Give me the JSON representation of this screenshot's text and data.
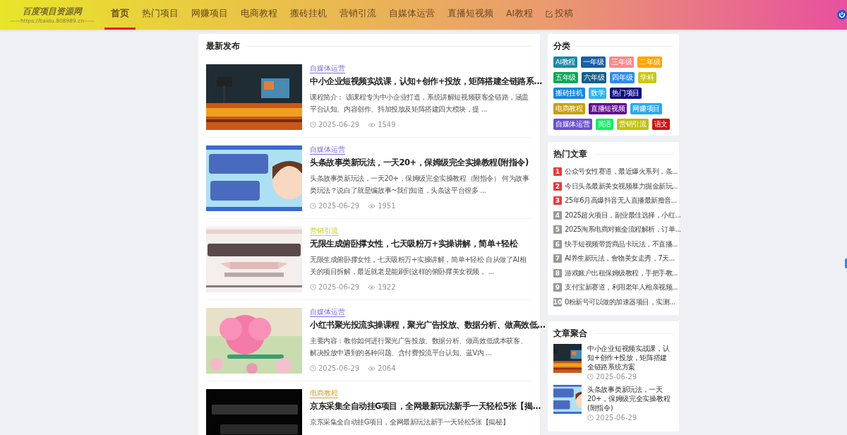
{
  "header": {
    "logo_title": "百度项目资源网",
    "logo_subtitle": "——https://baidu.808989.cn——",
    "nav": [
      {
        "label": "首页",
        "selected": true
      },
      {
        "label": "热门项目",
        "selected": false
      },
      {
        "label": "网赚项目",
        "selected": false
      },
      {
        "label": "电商教程",
        "selected": false
      },
      {
        "label": "搬砖挂机",
        "selected": false
      },
      {
        "label": "营销引流",
        "selected": false
      },
      {
        "label": "自媒体运营",
        "selected": false
      },
      {
        "label": "直播短视频",
        "selected": false
      },
      {
        "label": "AI教程",
        "selected": false
      },
      {
        "label": "投稿",
        "selected": false,
        "kind": "edit"
      }
    ]
  },
  "latest": {
    "title": "最新发布",
    "posts": [
      {
        "category": "自媒体运营",
        "color": "#7a6ad8",
        "title": "中小企业短视频实战课，认知+创作+投放，矩阵搭建全链路系...",
        "excerpt": "课程简介： 该课程专为中小企业打造，系统讲解短视频获客全链路，涵盖平台认知、内容创作、抖加投放及矩阵搭建四大模块，提 ...",
        "date": "2025-06-29",
        "views": "1549"
      },
      {
        "category": "自媒体运营",
        "color": "#7a6ad8",
        "title": "头条故事类新玩法，一天20+，保姆级完全实操教程(附指令)",
        "excerpt": "头条故事类新玩法，一天20+，保姆级完全实操教程（附指令） 何为故事类玩法？说白了就是编故事~我们知道，头条这平台很多 ...",
        "date": "2025-06-29",
        "views": "1951"
      },
      {
        "category": "营销引流",
        "color": "#c8c81a",
        "title": "无限生成俯卧撑女性，七天吸粉万+实操讲解，简单+轻松",
        "excerpt": "无限生成俯卧撑女性，七天吸粉万+实操讲解，简单+轻松 自从做了AI相关的项目拆解，最近就老是能刷到这样的俯卧撑美女视频， ...",
        "date": "2025-06-29",
        "views": "1922"
      },
      {
        "category": "自媒体运营",
        "color": "#7a6ad8",
        "title": "小红书聚光投流实操课程，聚光广告投放、数据分析、做高效低...",
        "excerpt": "主要内容：教你如何进行聚光广告投放、数据分析、做高效低成本获客、解决投放中遇到的各种问题、含付费投流平台认知、蓝V内 ...",
        "date": "2025-06-29",
        "views": "2064"
      },
      {
        "category": "电商教程",
        "color": "#d0a020",
        "title": "京东采集全自动挂G项目，全网最新玩法新手一天轻松5张【揭...",
        "excerpt": "京东采集全自动挂G项目，全网最新玩法新手一天轻松5张【揭秘】"
      }
    ]
  },
  "categories": {
    "title": "分类",
    "tags": [
      {
        "label": "AI教程",
        "color": "#1a8aa8"
      },
      {
        "label": "一年级",
        "color": "#1a5fa8"
      },
      {
        "label": "三年级",
        "color": "#f88a8a"
      },
      {
        "label": "二年级",
        "color": "#ffa500"
      },
      {
        "label": "五年级",
        "color": "#0ba85a"
      },
      {
        "label": "六年级",
        "color": "#155f86"
      },
      {
        "label": "四年级",
        "color": "#2e8af0"
      },
      {
        "label": "学科",
        "color": "#c8c81a"
      },
      {
        "label": "搬砖挂机",
        "color": "#1a88d8"
      },
      {
        "label": "数学",
        "color": "#2ab4f0"
      },
      {
        "label": "热门项目",
        "color": "#101080"
      },
      {
        "label": "电商教程",
        "color": "#c8a010"
      },
      {
        "label": "直播短视频",
        "color": "#601090"
      },
      {
        "label": "网赚项目",
        "color": "#2aa8f0"
      },
      {
        "label": "自媒体运营",
        "color": "#6a50d0"
      },
      {
        "label": "英语",
        "color": "#10f060"
      },
      {
        "label": "营销引流",
        "color": "#c0c010"
      },
      {
        "label": "语文",
        "color": "#d01010"
      }
    ]
  },
  "hot": {
    "title": "热门文章",
    "items": [
      {
        "rank": "1",
        "color": "#e83a3a",
        "title": "公众号女性赛道，最近爆火系列，条..."
      },
      {
        "rank": "2",
        "color": "#e83a3a",
        "title": "今日头条最新美女视频暴力掘金新玩..."
      },
      {
        "rank": "3",
        "color": "#e83a3a",
        "title": "25年6月高爆抖音无人直播最新撸音..."
      },
      {
        "rank": "4",
        "color": "#999999",
        "title": "2025超火项目，副业最佳选择，小红..."
      },
      {
        "rank": "5",
        "color": "#999999",
        "title": "2025淘系电商对账全流程解析，订单..."
      },
      {
        "rank": "6",
        "color": "#999999",
        "title": "快手短视频带货商品卡玩法，不直播..."
      },
      {
        "rank": "7",
        "color": "#999999",
        "title": "AI养生新玩法，食物美女走秀，7天..."
      },
      {
        "rank": "8",
        "color": "#999999",
        "title": "游戏账户出租保姆级教程，手把手教..."
      },
      {
        "rank": "9",
        "color": "#999999",
        "title": "支付宝新赛道，利用老年人相亲视频..."
      },
      {
        "rank": "10",
        "color": "#999999",
        "title": "0粉新号可以做的加速器项目，实测..."
      }
    ]
  },
  "aggregate": {
    "title": "文章聚合",
    "items": [
      {
        "title": "中小企业短视频实战课，认知+创作+投放，矩阵搭建全链路系统方案",
        "date": "2025-06-29"
      },
      {
        "title": "头条故事类新玩法，一天20+，保姆级完全实操教程(附指令)",
        "date": "2025-06-29"
      }
    ]
  }
}
